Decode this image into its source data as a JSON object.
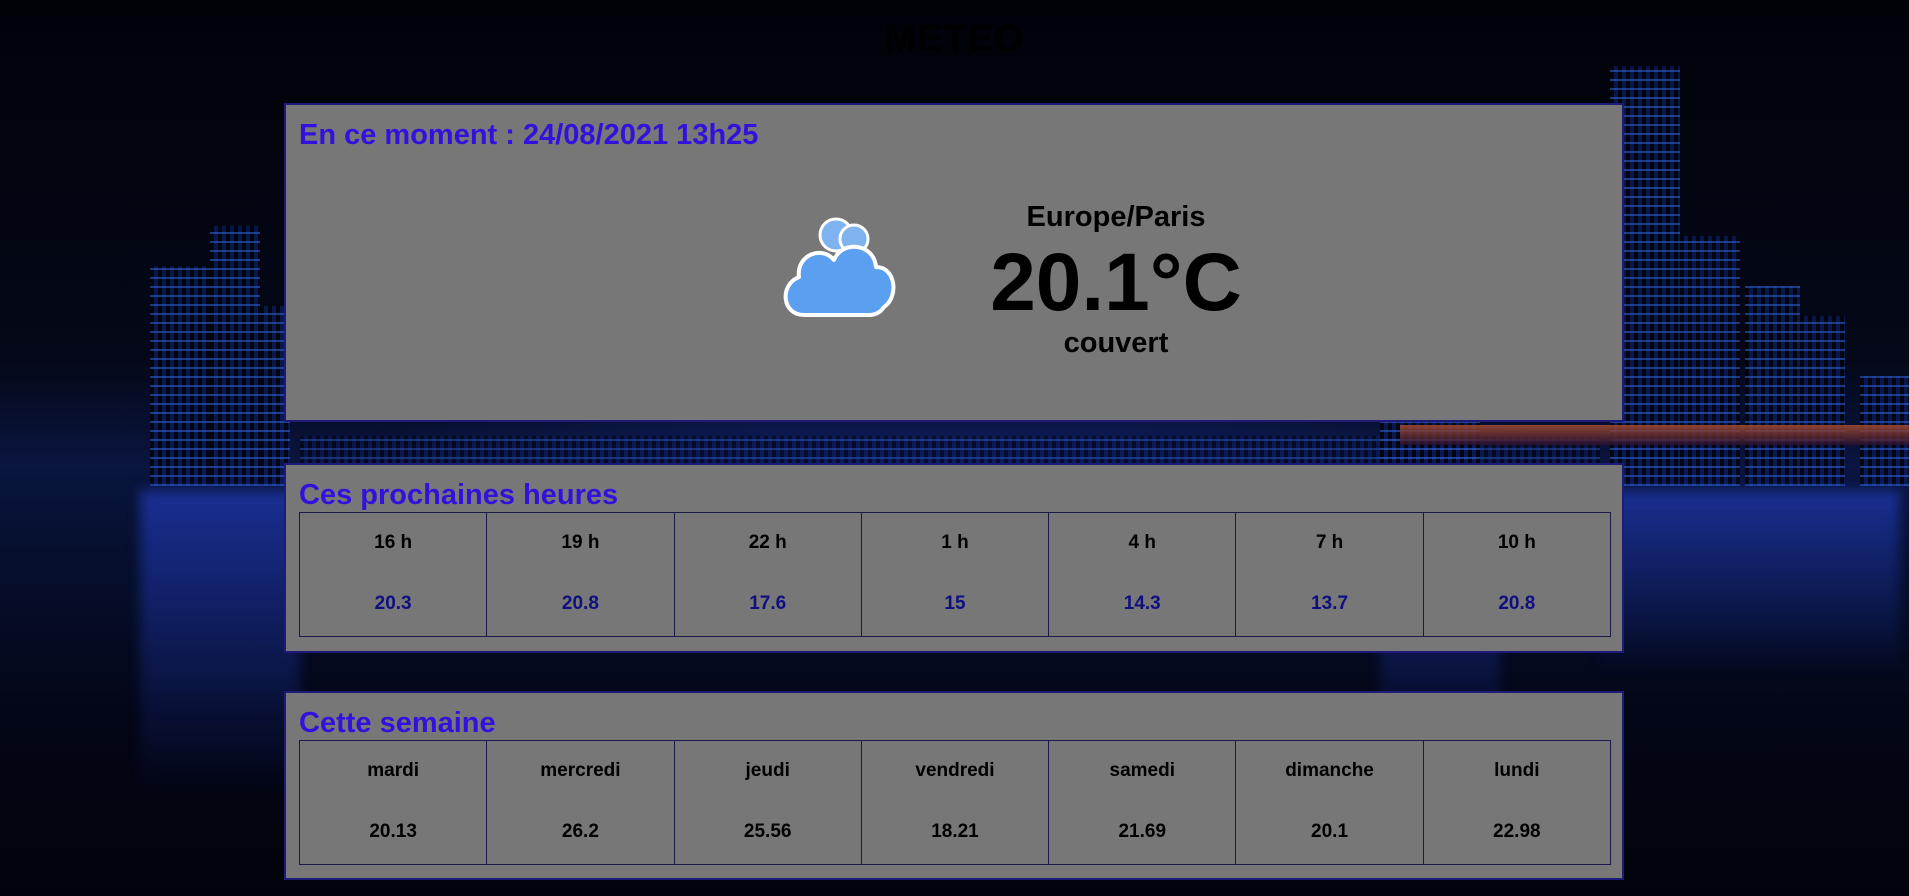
{
  "app": {
    "title": "METEO"
  },
  "current": {
    "heading": "En ce moment : 24/08/2021 13h25",
    "location": "Europe/Paris",
    "temperature": "20.1°C",
    "condition": "couvert",
    "icon": "cloud-icon"
  },
  "hourly": {
    "heading": "Ces prochaines heures",
    "items": [
      {
        "label": "16 h",
        "value": "20.3"
      },
      {
        "label": "19 h",
        "value": "20.8"
      },
      {
        "label": "22 h",
        "value": "17.6"
      },
      {
        "label": "1 h",
        "value": "15"
      },
      {
        "label": "4 h",
        "value": "14.3"
      },
      {
        "label": "7 h",
        "value": "13.7"
      },
      {
        "label": "10 h",
        "value": "20.8"
      }
    ]
  },
  "weekly": {
    "heading": "Cette semaine",
    "items": [
      {
        "label": "mardi",
        "value": "20.13"
      },
      {
        "label": "mercredi",
        "value": "26.2"
      },
      {
        "label": "jeudi",
        "value": "25.56"
      },
      {
        "label": "vendredi",
        "value": "18.21"
      },
      {
        "label": "samedi",
        "value": "21.69"
      },
      {
        "label": "dimanche",
        "value": "20.1"
      },
      {
        "label": "lundi",
        "value": "22.98"
      }
    ]
  },
  "colors": {
    "panel": "#777777",
    "heading": "#3311dd",
    "hourly_value": "#0f0f80",
    "border": "#1d1a7a",
    "cloud": "#5a9ff0"
  }
}
